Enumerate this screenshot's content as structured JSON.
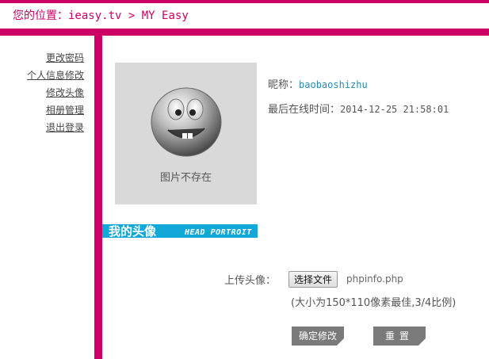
{
  "breadcrumb": {
    "label": "您的位置：",
    "site": "ieasy.tv",
    "separator": ">",
    "current": "MY Easy"
  },
  "sidebar": {
    "items": [
      {
        "label": "更改密码"
      },
      {
        "label": "个人信息修改"
      },
      {
        "label": "修改头像"
      },
      {
        "label": "相册管理"
      },
      {
        "label": "退出登录"
      }
    ]
  },
  "avatar": {
    "missing_text": "图片不存在"
  },
  "profile": {
    "nickname_label": "昵称：",
    "nickname": "baobaoshizhu",
    "last_online_label": "最后在线时间：",
    "last_online": "2014-12-25 21:58:01"
  },
  "banner": {
    "title_cn": "我的头像",
    "title_en": "HEAD PORTROIT"
  },
  "upload": {
    "label": "上传头像：",
    "choose_button": "选择文件",
    "file_name": "phpinfo.php",
    "hint": "(大小为150*110像素最佳,3/4比例)"
  },
  "actions": {
    "confirm_label": "确定修改",
    "reset_label": "重置"
  },
  "colors": {
    "brand": "#cc0066",
    "banner": "#12a8d8",
    "button": "#7a7a7a",
    "link": "#2a8ab0"
  },
  "icons": {
    "avatar_placeholder": "smiley-face-icon"
  }
}
